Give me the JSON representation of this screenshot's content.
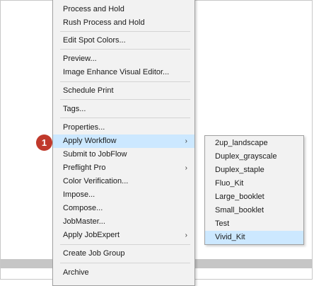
{
  "menu": {
    "items": [
      {
        "label": "Process and Hold"
      },
      {
        "label": "Rush Process and Hold"
      },
      {
        "label": "Edit Spot Colors..."
      },
      {
        "label": "Preview..."
      },
      {
        "label": "Image Enhance Visual Editor..."
      },
      {
        "label": "Schedule Print"
      },
      {
        "label": "Tags..."
      },
      {
        "label": "Properties..."
      },
      {
        "label": "Apply Workflow",
        "submenu_arrow": "›",
        "highlighted": true
      },
      {
        "label": "Submit to JobFlow"
      },
      {
        "label": "Preflight Pro",
        "submenu_arrow": "›"
      },
      {
        "label": "Color Verification..."
      },
      {
        "label": "Impose..."
      },
      {
        "label": "Compose..."
      },
      {
        "label": "JobMaster..."
      },
      {
        "label": "Apply JobExpert",
        "submenu_arrow": "›"
      },
      {
        "label": "Create Job Group"
      },
      {
        "label": "Archive"
      }
    ]
  },
  "submenu": {
    "items": [
      {
        "label": "2up_landscape"
      },
      {
        "label": "Duplex_grayscale"
      },
      {
        "label": "Duplex_staple"
      },
      {
        "label": "Fluo_Kit"
      },
      {
        "label": "Large_booklet"
      },
      {
        "label": "Small_booklet"
      },
      {
        "label": "Test"
      },
      {
        "label": "Vivid_Kit",
        "highlighted": true
      }
    ]
  },
  "callout": {
    "number": "1"
  },
  "colors": {
    "highlight": "#cce8ff",
    "callout": "#c0392b",
    "menu_background": "#f2f2f2"
  }
}
